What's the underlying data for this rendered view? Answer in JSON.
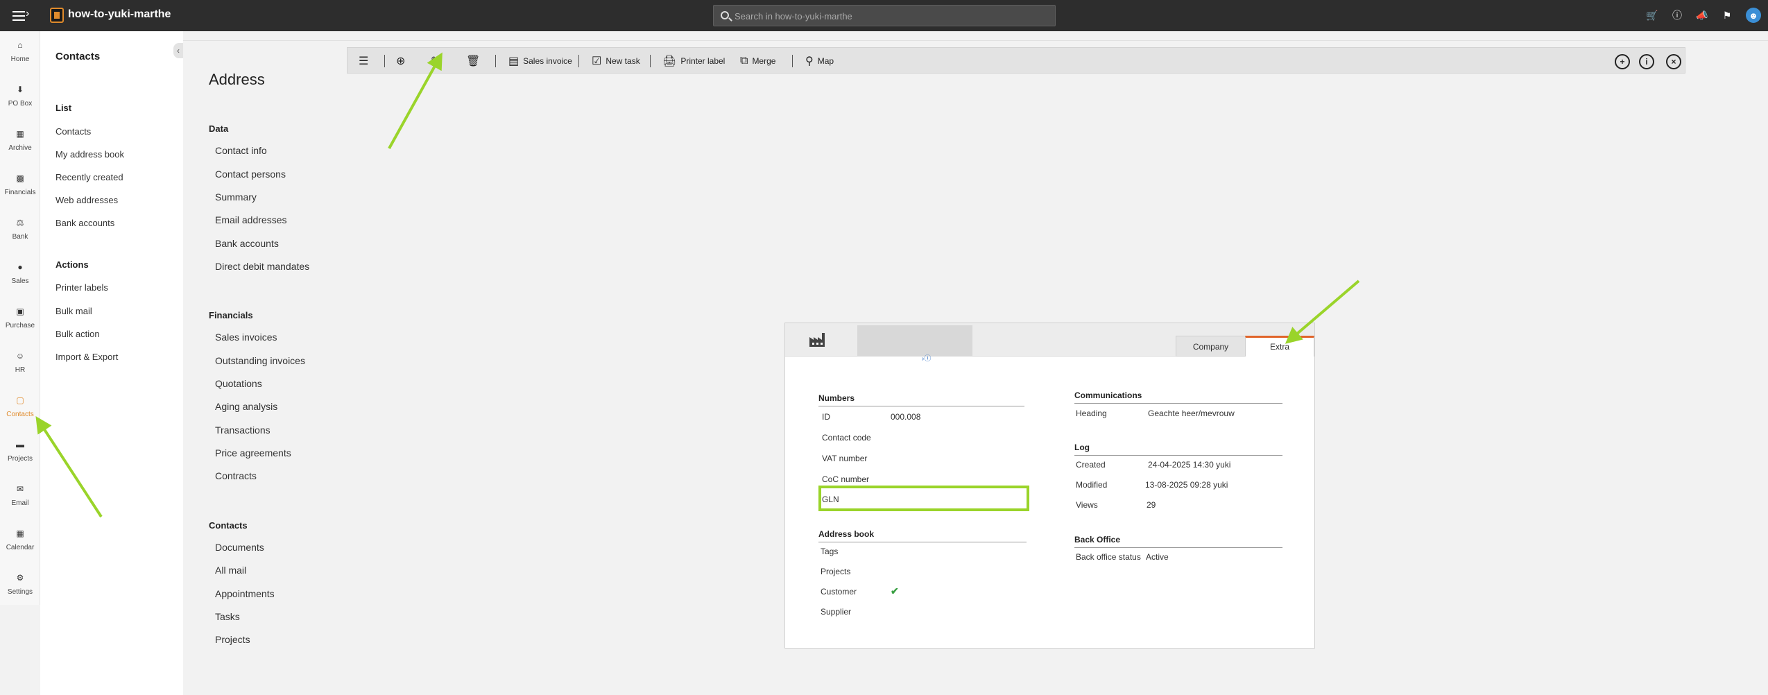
{
  "app": {
    "title": "how-to-yuki-marthe",
    "search_placeholder": "Search in how-to-yuki-marthe"
  },
  "rail": [
    {
      "label": "Home",
      "icon": "home-icon"
    },
    {
      "label": "PO Box",
      "icon": "inbox-icon"
    },
    {
      "label": "Archive",
      "icon": "archive-icon"
    },
    {
      "label": "Financials",
      "icon": "chart-icon"
    },
    {
      "label": "Bank",
      "icon": "bank-icon"
    },
    {
      "label": "Sales",
      "icon": "sales-icon"
    },
    {
      "label": "Purchase",
      "icon": "purchase-icon"
    },
    {
      "label": "HR",
      "icon": "people-icon"
    },
    {
      "label": "Contacts",
      "icon": "contacts-icon",
      "active": true
    },
    {
      "label": "Projects",
      "icon": "folder-icon"
    },
    {
      "label": "Email",
      "icon": "mail-icon"
    },
    {
      "label": "Calendar",
      "icon": "calendar-icon"
    },
    {
      "label": "Settings",
      "icon": "gear-icon"
    }
  ],
  "subnav": {
    "title": "Contacts",
    "list_heading": "List",
    "list": [
      "Contacts",
      "My address book",
      "Recently created",
      "Web addresses",
      "Bank accounts"
    ],
    "actions_heading": "Actions",
    "actions": [
      "Printer labels",
      "Bulk mail",
      "Bulk action",
      "Import & Export"
    ]
  },
  "toolbar": {
    "sales_invoice": "Sales invoice",
    "new_task": "New task",
    "printer_label": "Printer label",
    "merge": "Merge",
    "map": "Map"
  },
  "page": {
    "title": "Address",
    "sections": [
      {
        "heading": "Data",
        "links": [
          "Contact info",
          "Contact persons",
          "Summary",
          "Email addresses",
          "Bank accounts",
          "Direct debit mandates"
        ]
      },
      {
        "heading": "Financials",
        "links": [
          "Sales invoices",
          "Outstanding invoices",
          "Quotations",
          "Aging analysis",
          "Transactions",
          "Price agreements",
          "Contracts"
        ]
      },
      {
        "heading": "Contacts",
        "links": [
          "Documents",
          "All mail",
          "Appointments",
          "Tasks",
          "Projects"
        ]
      }
    ]
  },
  "card": {
    "tabs": {
      "company": "Company",
      "extra": "Extra"
    },
    "numbers": {
      "heading": "Numbers",
      "id_label": "ID",
      "id_value": "000.008",
      "contact_code_label": "Contact code",
      "vat_label": "VAT number",
      "coc_label": "CoC number",
      "gln_label": "GLN"
    },
    "address_book": {
      "heading": "Address book",
      "tags_label": "Tags",
      "projects_label": "Projects",
      "customer_label": "Customer",
      "supplier_label": "Supplier"
    },
    "communications": {
      "heading": "Communications",
      "heading_label": "Heading",
      "heading_value": "Geachte heer/mevrouw"
    },
    "log": {
      "heading": "Log",
      "created_label": "Created",
      "created_value": "24-04-2025 14:30 yuki",
      "modified_label": "Modified",
      "modified_value": "13-08-2025 09:28 yuki",
      "views_label": "Views",
      "views_value": "29"
    },
    "back_office": {
      "heading": "Back Office",
      "status_label": "Back office status",
      "status_value": "Active"
    }
  },
  "colors": {
    "accent": "#e08b2c",
    "highlight": "#9ad42a",
    "topbar": "#2d2d2d"
  }
}
